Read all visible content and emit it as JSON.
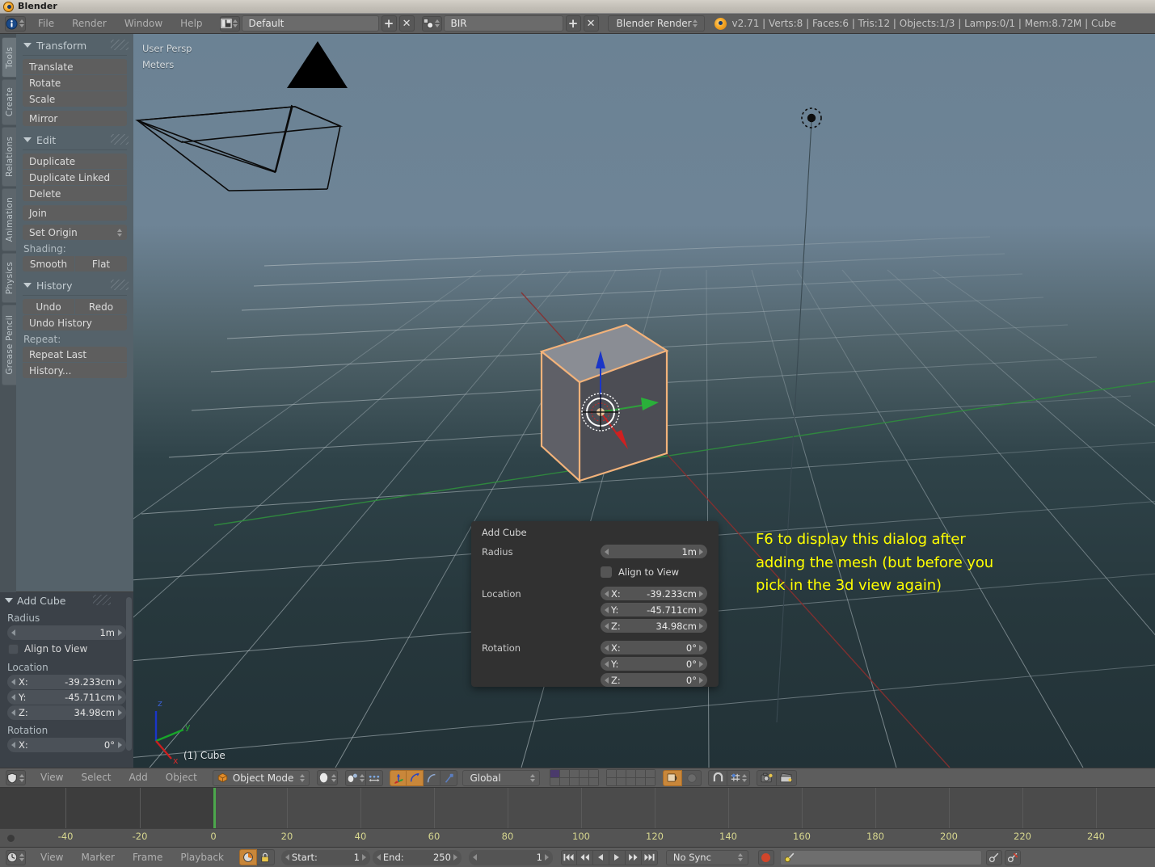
{
  "window": {
    "title": "Blender"
  },
  "topbar": {
    "menus": [
      "File",
      "Render",
      "Window",
      "Help"
    ],
    "screen_layout": {
      "value": "Default",
      "add_label": "+",
      "remove_label": "✕"
    },
    "scene": {
      "value": "BIR",
      "add_label": "+",
      "remove_label": "✕"
    },
    "render_engine": "Blender Render",
    "stats": "v2.71 | Verts:8 | Faces:6 | Tris:12 | Objects:1/3 | Lamps:0/1 | Mem:8.72M | Cube"
  },
  "vertical_tabs": [
    {
      "label": "Tools",
      "active": true
    },
    {
      "label": "Create",
      "active": false
    },
    {
      "label": "Relations",
      "active": false
    },
    {
      "label": "Animation",
      "active": false
    },
    {
      "label": "Physics",
      "active": false
    },
    {
      "label": "Grease Pencil",
      "active": false
    }
  ],
  "toolshelf": {
    "panels": [
      {
        "title": "Transform",
        "groups": [
          {
            "buttons": [
              "Translate",
              "Rotate",
              "Scale"
            ]
          },
          {
            "buttons": [
              "Mirror"
            ]
          }
        ]
      },
      {
        "title": "Edit",
        "groups": [
          {
            "buttons": [
              "Duplicate",
              "Duplicate Linked",
              "Delete"
            ]
          },
          {
            "buttons": [
              "Join"
            ]
          }
        ],
        "dropdown": "Set Origin",
        "shading_label": "Shading:",
        "shading_buttons": [
          "Smooth",
          "Flat"
        ]
      },
      {
        "title": "History",
        "pair": [
          "Undo",
          "Redo"
        ],
        "groups": [
          {
            "buttons": [
              "Undo History"
            ]
          }
        ],
        "repeat_label": "Repeat:",
        "repeat_buttons": [
          "Repeat Last",
          "History..."
        ]
      }
    ]
  },
  "operator_panel": {
    "title": "Add Cube",
    "radius_label": "Radius",
    "radius_value": "1m",
    "align_to_view_label": "Align to View",
    "align_to_view_checked": false,
    "location_label": "Location",
    "location": [
      {
        "axis": "X:",
        "value": "-39.233cm"
      },
      {
        "axis": "Y:",
        "value": "-45.711cm"
      },
      {
        "axis": "Z:",
        "value": "34.98cm"
      }
    ],
    "rotation_label": "Rotation",
    "rotation": [
      {
        "axis": "X:",
        "value": "0°"
      }
    ]
  },
  "viewport": {
    "view_name": "User Persp",
    "units": "Meters",
    "active_object": "(1) Cube",
    "axis_gizmo": {
      "x": "x",
      "y": "y",
      "z": "z"
    },
    "annotation": "F6 to display this dialog after\nadding the mesh (but before you\npick in the 3d view again)",
    "annotation_color": "#ffff00"
  },
  "popup_dialog": {
    "title": "Add Cube",
    "radius_label": "Radius",
    "radius_value": "1m",
    "align_to_view_label": "Align to View",
    "align_to_view_checked": false,
    "location_label": "Location",
    "location": [
      {
        "axis": "X:",
        "value": "-39.233cm"
      },
      {
        "axis": "Y:",
        "value": "-45.711cm"
      },
      {
        "axis": "Z:",
        "value": "34.98cm"
      }
    ],
    "rotation_label": "Rotation",
    "rotation": [
      {
        "axis": "X:",
        "value": "0°"
      },
      {
        "axis": "Y:",
        "value": "0°"
      },
      {
        "axis": "Z:",
        "value": "0°"
      }
    ]
  },
  "view3d_header": {
    "menus": [
      "View",
      "Select",
      "Add",
      "Object"
    ],
    "mode": "Object Mode",
    "transform_orientation": "Global"
  },
  "timeline": {
    "ticks": [
      "-40",
      "-20",
      "0",
      "20",
      "40",
      "60",
      "80",
      "100",
      "120",
      "140",
      "160",
      "180",
      "200",
      "220",
      "240"
    ],
    "playhead_frame": "0"
  },
  "bottombar": {
    "menus": [
      "View",
      "Marker",
      "Frame",
      "Playback"
    ],
    "start_label": "Start:",
    "start_value": "1",
    "end_label": "End:",
    "end_value": "250",
    "current_frame": "1",
    "sync_mode": "No Sync"
  }
}
